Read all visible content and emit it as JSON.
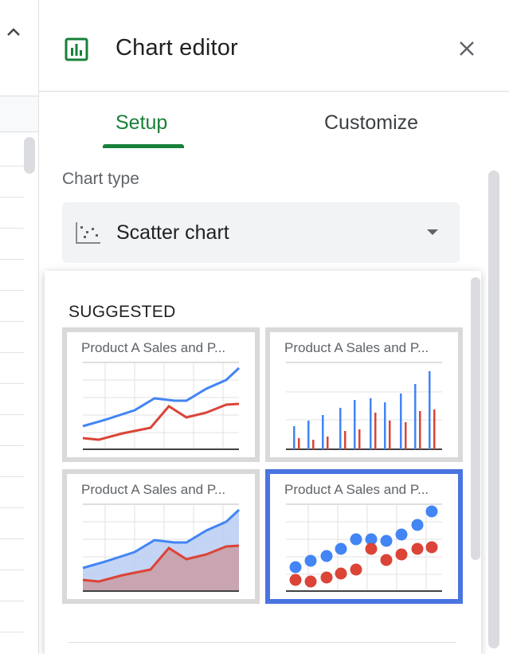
{
  "panel": {
    "title": "Chart editor",
    "tabs": [
      {
        "label": "Setup",
        "active": true
      },
      {
        "label": "Customize",
        "active": false
      }
    ]
  },
  "chart_type": {
    "label": "Chart type",
    "selected": "Scatter chart"
  },
  "suggested": {
    "label": "SUGGESTED",
    "thumbnails": [
      {
        "title": "Product A Sales and P...",
        "kind": "line",
        "selected": false
      },
      {
        "title": "Product A Sales and P...",
        "kind": "column",
        "selected": false
      },
      {
        "title": "Product A Sales and P...",
        "kind": "area",
        "selected": false
      },
      {
        "title": "Product A Sales and P...",
        "kind": "scatter",
        "selected": true
      }
    ]
  },
  "colors": {
    "accent": "#188038",
    "series_blue": "#4285f4",
    "series_red": "#db4437",
    "selection": "#4a74e0"
  },
  "icons": [
    "chart-icon",
    "close-icon",
    "scatter-chart-icon",
    "dropdown-arrow-icon",
    "chevron-up-icon"
  ]
}
